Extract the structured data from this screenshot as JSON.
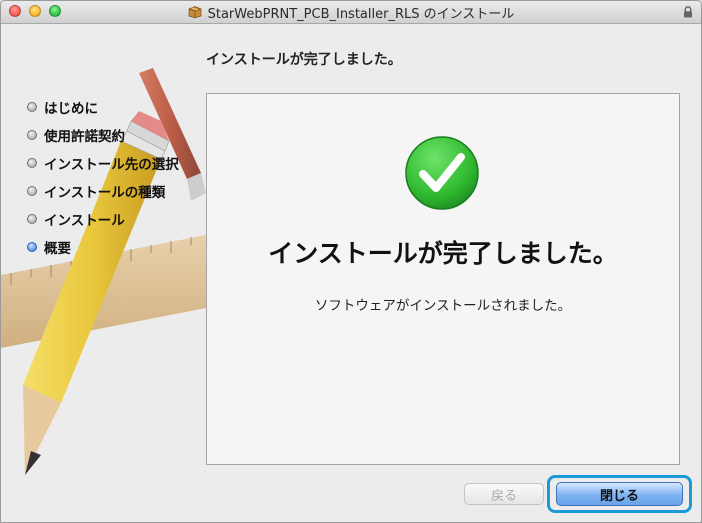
{
  "window": {
    "title": "StarWebPRNT_PCB_Installer_RLS のインストール",
    "icons": {
      "package": "package-icon",
      "lock": "lock-icon"
    }
  },
  "header": {
    "title": "インストールが完了しました。"
  },
  "steps": [
    {
      "label": "はじめに",
      "active": false
    },
    {
      "label": "使用許諾契約",
      "active": false
    },
    {
      "label": "インストール先の選択",
      "active": false
    },
    {
      "label": "インストールの種類",
      "active": false
    },
    {
      "label": "インストール",
      "active": false
    },
    {
      "label": "概要",
      "active": true
    }
  ],
  "panel": {
    "heading": "インストールが完了しました。",
    "message": "ソフトウェアがインストールされました。",
    "icon": "checkmark-icon"
  },
  "buttons": {
    "back": {
      "label": "戻る",
      "enabled": false
    },
    "close": {
      "label": "閉じる",
      "enabled": true,
      "highlighted": true
    }
  },
  "colors": {
    "traffic_close": "#fc5f57",
    "traffic_minimize": "#fdbc2e",
    "traffic_zoom": "#33c748",
    "check_green": "#2eb82e",
    "highlight_ring": "#1a9ad6",
    "active_step": "#2d6fd6"
  }
}
